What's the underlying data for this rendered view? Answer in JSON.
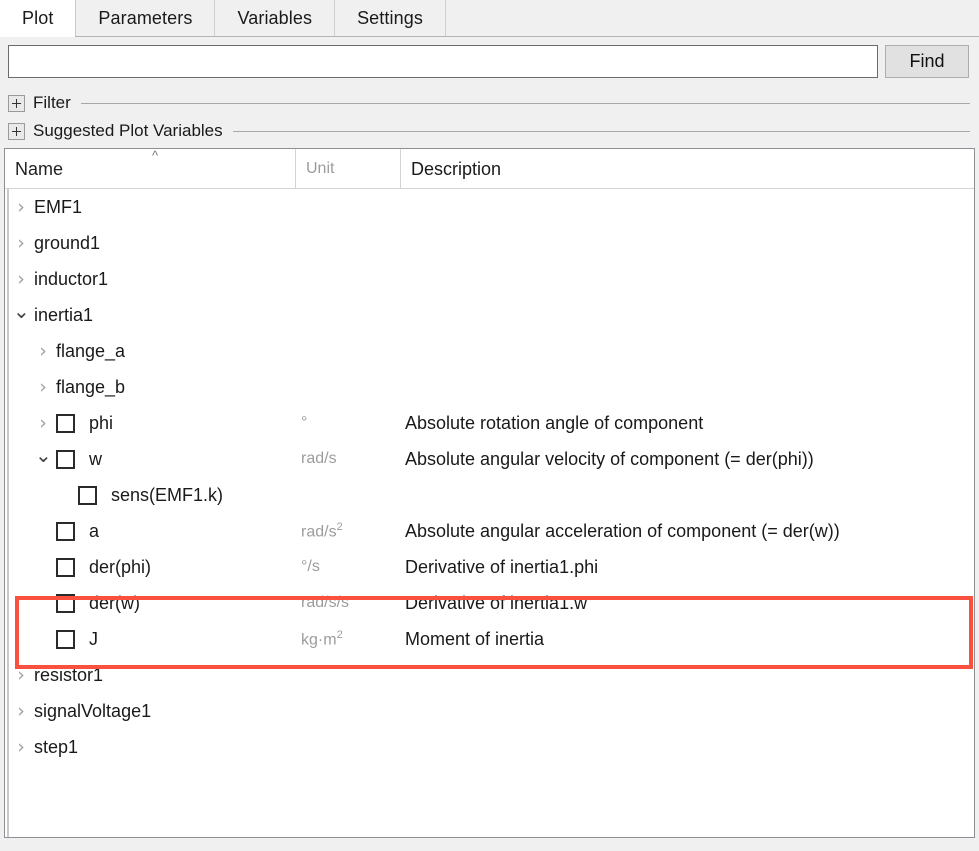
{
  "tabs": [
    {
      "label": "Plot",
      "active": true
    },
    {
      "label": "Parameters",
      "active": false
    },
    {
      "label": "Variables",
      "active": false
    },
    {
      "label": "Settings",
      "active": false
    }
  ],
  "search": {
    "value": "",
    "placeholder": "",
    "find_label": "Find"
  },
  "sections": [
    {
      "label": "Filter",
      "expanded": false,
      "expander_icon": "plus-icon"
    },
    {
      "label": "Suggested Plot Variables",
      "expanded": false,
      "expander_icon": "plus-icon"
    }
  ],
  "columns": {
    "name": "Name",
    "unit": "Unit",
    "description": "Description",
    "sort_indicator": "caret-up-icon"
  },
  "highlight": {
    "color": "#f9503f",
    "target_row": "w"
  },
  "rows": [
    {
      "name": "EMF1",
      "indent": 0,
      "twisty": "collapsed",
      "checkbox": false,
      "unit": "",
      "unit_sup": "",
      "desc": ""
    },
    {
      "name": "ground1",
      "indent": 0,
      "twisty": "collapsed",
      "checkbox": false,
      "unit": "",
      "unit_sup": "",
      "desc": ""
    },
    {
      "name": "inductor1",
      "indent": 0,
      "twisty": "collapsed",
      "checkbox": false,
      "unit": "",
      "unit_sup": "",
      "desc": ""
    },
    {
      "name": "inertia1",
      "indent": 0,
      "twisty": "expanded",
      "checkbox": false,
      "unit": "",
      "unit_sup": "",
      "desc": ""
    },
    {
      "name": "flange_a",
      "indent": 1,
      "twisty": "collapsed",
      "checkbox": false,
      "unit": "",
      "unit_sup": "",
      "desc": ""
    },
    {
      "name": "flange_b",
      "indent": 1,
      "twisty": "collapsed",
      "checkbox": false,
      "unit": "",
      "unit_sup": "",
      "desc": ""
    },
    {
      "name": "phi",
      "indent": 1,
      "twisty": "collapsed",
      "checkbox": true,
      "unit": "°",
      "unit_sup": "",
      "desc": "Absolute rotation angle of component"
    },
    {
      "name": "w",
      "indent": 1,
      "twisty": "expanded",
      "checkbox": true,
      "unit": "rad/s",
      "unit_sup": "",
      "desc": "Absolute angular velocity of component (= der(phi))"
    },
    {
      "name": "sens(EMF1.k)",
      "indent": 2,
      "twisty": "none",
      "checkbox": true,
      "unit": "",
      "unit_sup": "",
      "desc": ""
    },
    {
      "name": "a",
      "indent": 1,
      "twisty": "none",
      "checkbox": true,
      "unit": "rad/s",
      "unit_sup": "2",
      "desc": "Absolute angular acceleration of component (= der(w))"
    },
    {
      "name": "der(phi)",
      "indent": 1,
      "twisty": "none",
      "checkbox": true,
      "unit": "°/s",
      "unit_sup": "",
      "desc": "Derivative of inertia1.phi"
    },
    {
      "name": "der(w)",
      "indent": 1,
      "twisty": "none",
      "checkbox": true,
      "unit": "rad/s/s",
      "unit_sup": "",
      "desc": "Derivative of inertia1.w"
    },
    {
      "name": "J",
      "indent": 1,
      "twisty": "none",
      "checkbox": true,
      "unit": "kg·m",
      "unit_sup": "2",
      "desc": "Moment of inertia"
    },
    {
      "name": "resistor1",
      "indent": 0,
      "twisty": "collapsed",
      "checkbox": false,
      "unit": "",
      "unit_sup": "",
      "desc": ""
    },
    {
      "name": "signalVoltage1",
      "indent": 0,
      "twisty": "collapsed",
      "checkbox": false,
      "unit": "",
      "unit_sup": "",
      "desc": ""
    },
    {
      "name": "step1",
      "indent": 0,
      "twisty": "collapsed",
      "checkbox": false,
      "unit": "",
      "unit_sup": "",
      "desc": ""
    }
  ]
}
